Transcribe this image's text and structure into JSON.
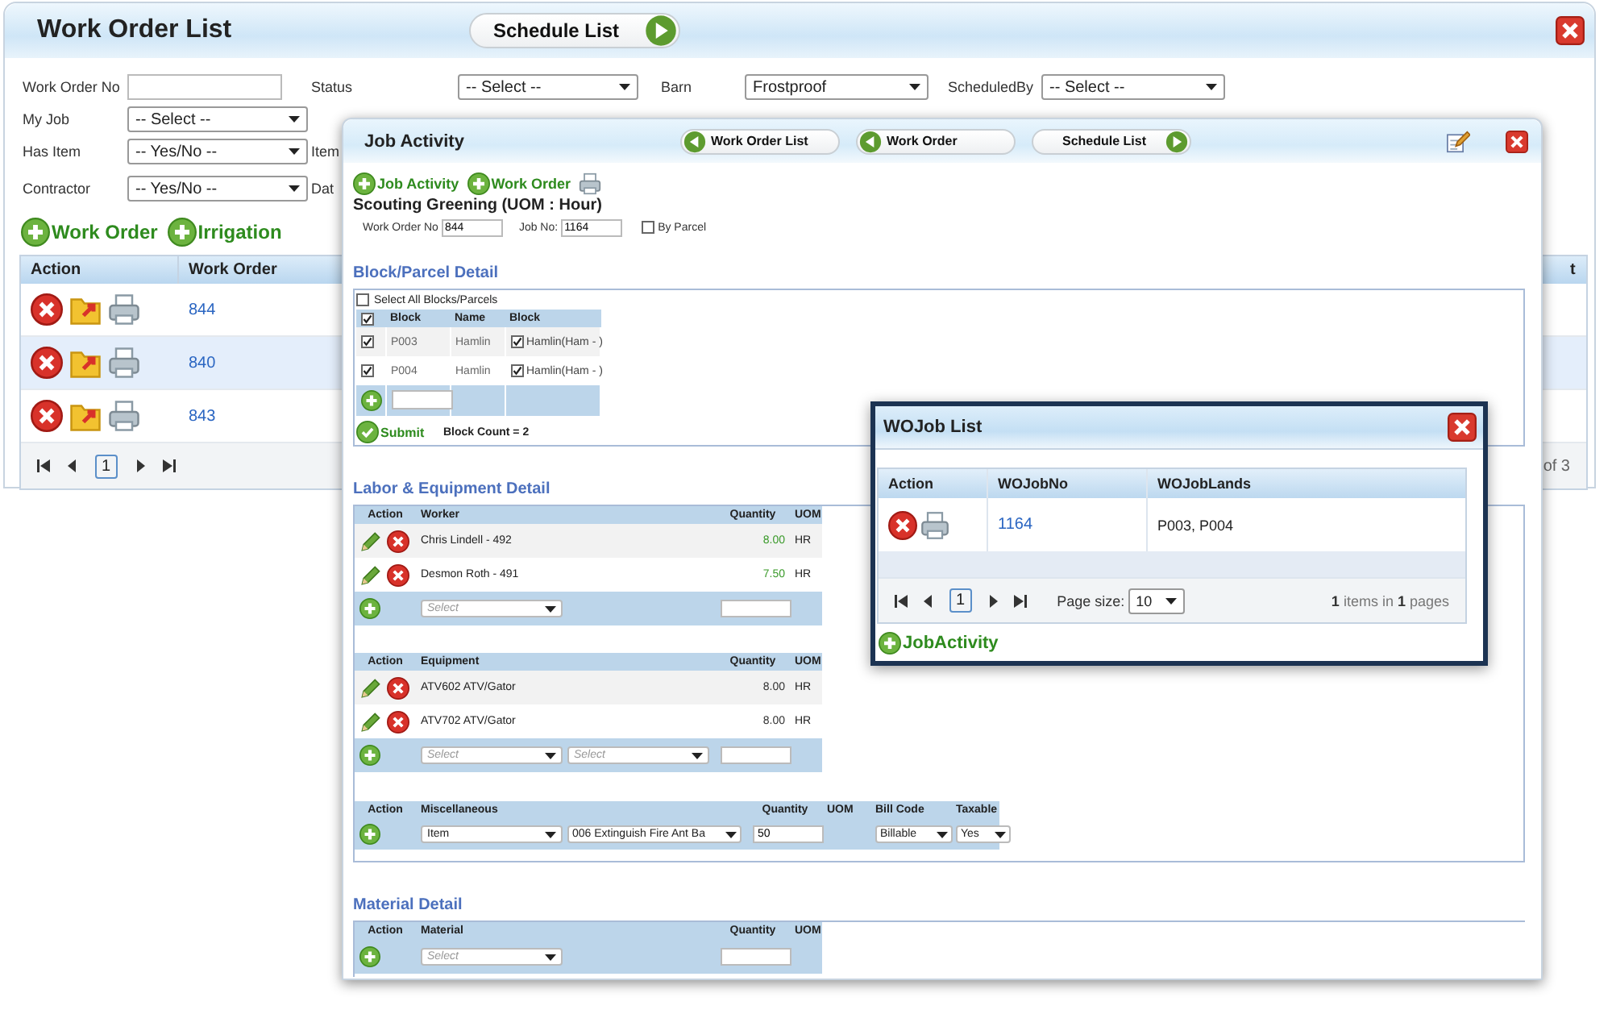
{
  "main_window": {
    "title": "Work Order List",
    "nav_button": {
      "label": "Schedule List",
      "kind": "forward"
    },
    "filters": [
      [
        {
          "label": "Work Order No",
          "kind": "text"
        },
        {
          "label": "Status",
          "kind": "select",
          "value": "-- Select --"
        },
        {
          "label": "Barn",
          "kind": "select",
          "value": "Frostproof"
        },
        {
          "label": "ScheduledBy",
          "kind": "select",
          "value": "-- Select --"
        }
      ],
      [
        {
          "label": "My Job",
          "kind": "select",
          "value": "-- Select --"
        }
      ],
      [
        {
          "label": "Has Item",
          "kind": "select",
          "value": "-- Yes/No --"
        },
        {
          "label": "Item",
          "kind": "label"
        }
      ],
      [
        {
          "label": "Contractor",
          "kind": "select",
          "value": "-- Yes/No --"
        },
        {
          "label": "Dat",
          "kind": "label"
        }
      ]
    ],
    "add_links": [
      "Work Order",
      "Irrigation"
    ],
    "grid": {
      "columns": [
        "Action",
        "Work Order",
        "t"
      ],
      "rows": [
        {
          "work_order": "844"
        },
        {
          "work_order": "840"
        },
        {
          "work_order": "843"
        }
      ],
      "pager": {
        "page": "1",
        "info": "of 3"
      }
    }
  },
  "job_activity": {
    "title": "Job Activity",
    "nav_buttons": [
      {
        "label": "Work Order List",
        "kind": "back"
      },
      {
        "label": "Work Order",
        "kind": "back"
      },
      {
        "label": "Schedule List",
        "kind": "forward"
      }
    ],
    "add_links": [
      "Job Activity",
      "Work Order"
    ],
    "job_title": "Scouting Greening (UOM : Hour)",
    "fields": [
      {
        "label": "Work Order No",
        "value": "844"
      },
      {
        "label": "Job No:",
        "value": "1164"
      }
    ],
    "by_parcel": {
      "label": "By Parcel",
      "checked": false
    },
    "block_section": {
      "heading": "Block/Parcel Detail",
      "select_all": {
        "label": "Select All Blocks/Parcels",
        "checked": false
      },
      "header_checked": true,
      "columns": [
        "Block",
        "Name",
        "Block"
      ],
      "rows": [
        {
          "checked": true,
          "block": "P003",
          "name": "Hamlin",
          "land_checked": true,
          "land": "Hamlin(Ham - )"
        },
        {
          "checked": true,
          "block": "P004",
          "name": "Hamlin",
          "land_checked": true,
          "land": "Hamlin(Ham - )"
        }
      ],
      "submit": "Submit",
      "count": "Block Count = 2"
    },
    "labor_heading": "Labor & Equipment Detail",
    "tables": [
      {
        "kind": "worker",
        "columns": [
          "Action",
          "Worker",
          "Quantity",
          "UOM"
        ],
        "rows": [
          {
            "name": "Chris Lindell - 492",
            "quantity": "8.00",
            "uom": "HR"
          },
          {
            "name": "Desmon Roth - 491",
            "quantity": "7.50",
            "uom": "HR"
          }
        ],
        "add_selects": [
          {
            "placeholder": "Select"
          }
        ]
      },
      {
        "kind": "equipment",
        "columns": [
          "Action",
          "Equipment",
          "Quantity",
          "UOM"
        ],
        "rows": [
          {
            "name": "ATV602 ATV/Gator",
            "quantity": "8.00",
            "uom": "HR"
          },
          {
            "name": "ATV702 ATV/Gator",
            "quantity": "8.00",
            "uom": "HR"
          }
        ],
        "add_selects": [
          {
            "placeholder": "Select"
          },
          {
            "placeholder": "Select"
          }
        ]
      },
      {
        "kind": "misc",
        "columns": [
          "Action",
          "Miscellaneous",
          "Quantity",
          "UOM",
          "Bill Code",
          "Taxable"
        ],
        "add_selects": [
          {
            "value": "Item"
          },
          {
            "value": "006 Extinguish Fire Ant Ba"
          }
        ],
        "quantity": "50",
        "bill_code": "Billable",
        "taxable": "Yes"
      }
    ],
    "material_heading": "Material Detail",
    "material_table": {
      "columns": [
        "Action",
        "Material",
        "Quantity",
        "UOM"
      ],
      "add_selects": [
        {
          "placeholder": "Select"
        }
      ]
    }
  },
  "wojob_list": {
    "title": "WOJob List",
    "columns": [
      "Action",
      "WOJobNo",
      "WOJobLands"
    ],
    "rows": [
      {
        "job_no": "1164",
        "lands": "P003, P004"
      }
    ],
    "pager": {
      "page": "1",
      "page_size_label": "Page size:",
      "page_size": "10",
      "info": "**1** items in **1** pages"
    },
    "add_link": "JobActivity"
  }
}
